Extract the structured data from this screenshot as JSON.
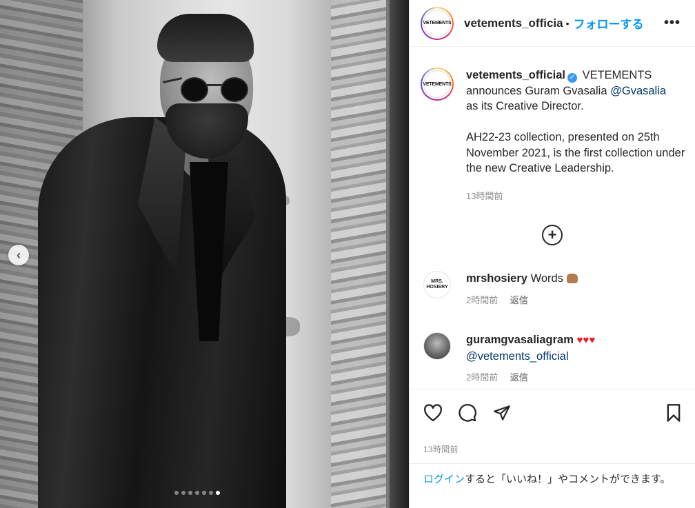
{
  "photo": {
    "carousel_prev_glyph": "‹",
    "dot_count": 7,
    "active_dot": 6
  },
  "header": {
    "avatar_text": "VETEMENTS",
    "username": "vetements_officia",
    "separator": "•",
    "follow_label": "フォローする",
    "more_glyph": "•••"
  },
  "caption": {
    "avatar_text": "VETEMENTS",
    "username": "vetements_official",
    "verified_glyph": "✓",
    "text_part1": "VETEMENTS announces Guram Gvasalia",
    "mention": "@Gvasalia",
    "text_part2": "as its Creative Director.",
    "paragraph2": "AH22-23 collection, presented on 25th November 2021, is the first collection under the new Creative Leadership.",
    "time": "13時間前"
  },
  "load_more_glyph": "+",
  "comments": [
    {
      "avatar_text": "MRS. HOSIERY",
      "username": "mrshosiery",
      "text": "Words",
      "time": "2時間前",
      "reply": "返信"
    },
    {
      "username": "guramgvasaliagram",
      "hearts": "♥♥♥",
      "mention": "@vetements_official",
      "time": "2時間前",
      "reply": "返信"
    }
  ],
  "post_time": "13時間前",
  "login": {
    "link": "ログイン",
    "text": "すると「いいね！」やコメントができます。"
  },
  "colors": {
    "accent": "#0095f6",
    "mention": "#00376b",
    "muted": "#8e8e8e",
    "verified": "#3897f0",
    "heart": "#ed1c24"
  },
  "icons": [
    "chevron-left-icon",
    "more-icon",
    "verified-icon",
    "plus-circle-icon",
    "heart-icon",
    "comment-icon",
    "share-icon",
    "bookmark-icon"
  ]
}
